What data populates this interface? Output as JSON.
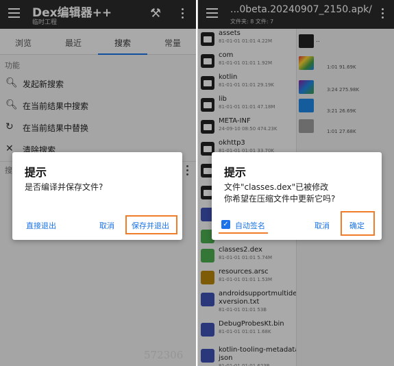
{
  "left": {
    "app_title": "Dex编辑器++",
    "app_subtitle": "临时工程",
    "tabs": [
      "浏览",
      "最近",
      "搜索",
      "常量"
    ],
    "section_title": "功能",
    "actions": [
      {
        "icon": "search-icon",
        "label": "发起新搜索"
      },
      {
        "icon": "search-icon",
        "label": "在当前结果中搜索"
      },
      {
        "icon": "replace-icon",
        "label": "在当前结果中替换"
      },
      {
        "icon": "close-icon",
        "label": "清除搜索"
      }
    ],
    "section2_title": "搜",
    "dialog": {
      "title": "提示",
      "message": "是否编译并保存文件?",
      "btn_exit": "直接退出",
      "btn_cancel": "取消",
      "btn_save": "保存并退出"
    },
    "watermark": "572306"
  },
  "right": {
    "path": "...0beta.20240907_2150.apk/",
    "path_info": "文件夹: 8  文件: 7",
    "files": [
      {
        "name": "assets",
        "meta": "81-01-01 01:01  4.22M",
        "type": "folder"
      },
      {
        "name": "com",
        "meta": "81-01-01 01:01  1.92M",
        "type": "folder"
      },
      {
        "name": "kotlin",
        "meta": "81-01-01 01:01  29.19K",
        "type": "folder"
      },
      {
        "name": "lib",
        "meta": "81-01-01 01:01  47.18M",
        "type": "folder"
      },
      {
        "name": "META-INF",
        "meta": "24-09-10 08:50  474.23K",
        "type": "folder"
      },
      {
        "name": "okhttp3",
        "meta": "81-01-01 01:01  33.70K",
        "type": "folder"
      },
      {
        "name": "",
        "meta": "",
        "type": "folder"
      },
      {
        "name": "",
        "meta": "",
        "type": "folder"
      },
      {
        "name": "",
        "meta": "",
        "type": "doc"
      },
      {
        "name": "",
        "meta": "",
        "type": "green"
      },
      {
        "name": "classes2.dex",
        "meta": "81-01-01 01:01  5.74M",
        "type": "green"
      },
      {
        "name": "resources.arsc",
        "meta": "81-01-01 01:01  1.53M",
        "type": "gold"
      },
      {
        "name": "androidsupportmultide\nxversion.txt",
        "meta": "81-01-01 01:01  53B",
        "type": "doc"
      },
      {
        "name": "DebugProbesKt.bin",
        "meta": "81-01-01 01:01  1.68K",
        "type": "doc"
      },
      {
        "name": "kotlin-tooling-metadata.\njson",
        "meta": "81-01-01 01:01  623B",
        "type": "doc"
      }
    ],
    "rpane_items": [
      {
        "label": "..",
        "meta": ""
      },
      {
        "label": "",
        "meta": "1:01  91.69K"
      },
      {
        "label": "",
        "meta": "3:24  275.98K"
      },
      {
        "label": "",
        "meta": "3:21  26.69K"
      },
      {
        "label": "",
        "meta": "1:01  27.68K"
      }
    ],
    "dialog": {
      "title": "提示",
      "message_line1": "文件\"classes.dex\"已被修改",
      "message_line2": "你希望在压缩文件中更新它吗?",
      "checkbox_label": "自动签名",
      "checkbox_checked": true,
      "btn_cancel": "取消",
      "btn_ok": "确定"
    }
  },
  "colors": {
    "appbar": "#2b2b2b",
    "accent": "#1a73e8",
    "highlight": "#f07c2a"
  }
}
